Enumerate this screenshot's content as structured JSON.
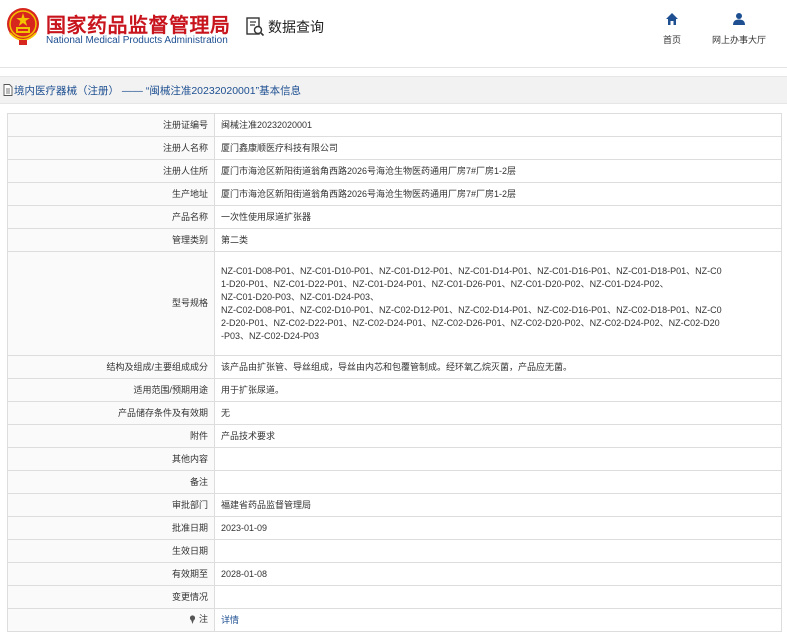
{
  "header": {
    "site_title_cn": "国家药品监督管理局",
    "site_title_en": "National Medical Products Administration",
    "query_label": "数据查询",
    "nav": {
      "home_label": "首页",
      "office_label": "网上办事大厅"
    },
    "colors": {
      "brand_red": "#c8151d",
      "brand_blue": "#1d4f91"
    }
  },
  "breadcrumb": {
    "text": "境内医疗器械（注册） —— “闽械注准20232020001”基本信息"
  },
  "detail": {
    "rows": [
      {
        "label": "注册证编号",
        "value": "闽械注准20232020001"
      },
      {
        "label": "注册人名称",
        "value": "厦门鑫康顺医疗科技有限公司"
      },
      {
        "label": "注册人住所",
        "value": "厦门市海沧区新阳街道翁角西路2026号海沧生物医药通用厂房7#厂房1-2层"
      },
      {
        "label": "生产地址",
        "value": "厦门市海沧区新阳街道翁角西路2026号海沧生物医药通用厂房7#厂房1-2层"
      },
      {
        "label": "产品名称",
        "value": "一次性使用尿道扩张器"
      },
      {
        "label": "管理类别",
        "value": "第二类"
      },
      {
        "label": "型号规格",
        "lines": [
          "NZ-C01-D08-P01、NZ-C01-D10-P01、NZ-C01-D12-P01、NZ-C01-D14-P01、NZ-C01-D16-P01、NZ-C01-D18-P01、NZ-C0",
          "1-D20-P01、NZ-C01-D22-P01、NZ-C01-D24-P01、NZ-C01-D26-P01、NZ-C01-D20-P02、NZ-C01-D24-P02、",
          "NZ-C01-D20-P03、NZ-C01-D24-P03、",
          "NZ-C02-D08-P01、NZ-C02-D10-P01、NZ-C02-D12-P01、NZ-C02-D14-P01、NZ-C02-D16-P01、NZ-C02-D18-P01、NZ-C0",
          "2-D20-P01、NZ-C02-D22-P01、NZ-C02-D24-P01、NZ-C02-D26-P01、NZ-C02-D20-P02、NZ-C02-D24-P02、NZ-C02-D20",
          "-P03、NZ-C02-D24-P03"
        ]
      },
      {
        "label": "结构及组成/主要组成成分",
        "value": "该产品由扩张管、导丝组成，导丝由内芯和包覆管制成。经环氧乙烷灭菌，产品应无菌。"
      },
      {
        "label": "适用范围/预期用途",
        "value": "用于扩张尿道。"
      },
      {
        "label": "产品储存条件及有效期",
        "value": "无"
      },
      {
        "label": "附件",
        "value": "产品技术要求"
      },
      {
        "label": "其他内容",
        "value": ""
      },
      {
        "label": "备注",
        "value": ""
      },
      {
        "label": "审批部门",
        "value": "福建省药品监督管理局"
      },
      {
        "label": "批准日期",
        "value": "2023-01-09"
      },
      {
        "label": "生效日期",
        "value": ""
      },
      {
        "label": "有效期至",
        "value": "2028-01-08"
      },
      {
        "label": "变更情况",
        "value": ""
      },
      {
        "label": "注",
        "value": "详情",
        "icon": "pin-icon"
      }
    ]
  }
}
